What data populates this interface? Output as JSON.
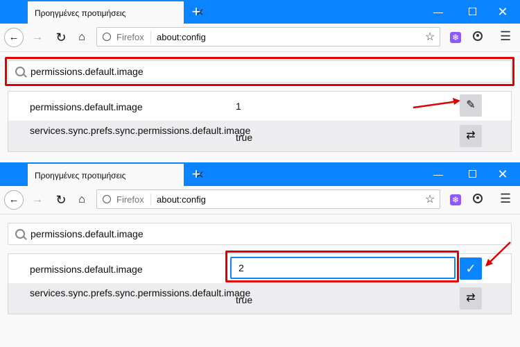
{
  "tab": {
    "title": "Προηγμένες προτιμήσεις",
    "close": "✕",
    "new": "+"
  },
  "window": {
    "minimize": "—",
    "close": "✕"
  },
  "nav": {
    "back": "←",
    "forward": "→",
    "reload": "↻",
    "home": "⌂"
  },
  "urlbar": {
    "identity_label": "Firefox",
    "url": "about:config",
    "bookmark": "☆"
  },
  "toolbar": {
    "extension": "❄",
    "menu": "☰"
  },
  "search": {
    "value": "permissions.default.image"
  },
  "prefs": [
    {
      "name": "permissions.default.image",
      "value": "1",
      "edit_icon": "✎"
    },
    {
      "name": "services.sync.prefs.sync.permissions.default.image",
      "value": "true",
      "toggle_icon": "⇄"
    }
  ],
  "edit_mode": {
    "input_value": "2",
    "save_icon": "✓"
  },
  "colors": {
    "accent": "#0a84ff",
    "highlight": "#e00000",
    "arrow": "#e00000"
  }
}
